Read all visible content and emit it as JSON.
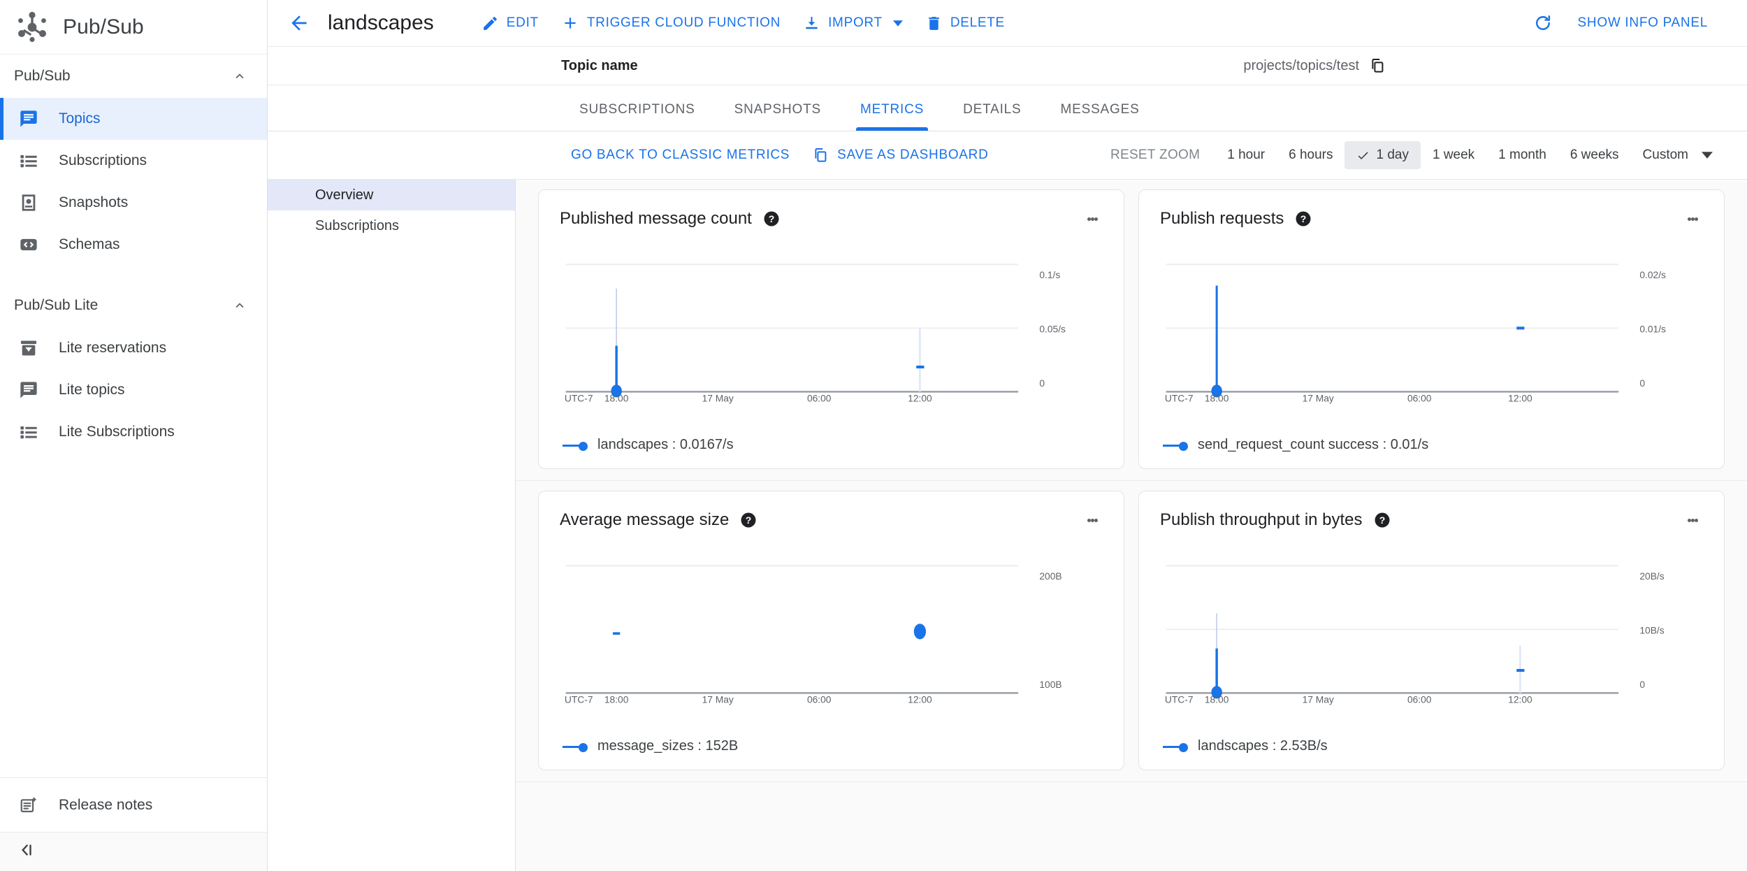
{
  "brand": {
    "title": "Pub/Sub",
    "logo_icon": "pubsub-node-graph-icon"
  },
  "sidebar": {
    "sections": [
      {
        "label": "Pub/Sub",
        "items": [
          {
            "label": "Topics",
            "icon": "chat-bubble-icon",
            "active": true
          },
          {
            "label": "Subscriptions",
            "icon": "list-icon",
            "active": false
          },
          {
            "label": "Snapshots",
            "icon": "snapshot-icon",
            "active": false
          },
          {
            "label": "Schemas",
            "icon": "code-brackets-icon",
            "active": false
          }
        ]
      },
      {
        "label": "Pub/Sub Lite",
        "items": [
          {
            "label": "Lite reservations",
            "icon": "archive-icon",
            "active": false
          },
          {
            "label": "Lite topics",
            "icon": "chat-bubble-icon",
            "active": false
          },
          {
            "label": "Lite Subscriptions",
            "icon": "list-icon",
            "active": false
          }
        ]
      }
    ],
    "release_notes": {
      "label": "Release notes",
      "icon": "release-notes-icon"
    },
    "collapse_icon": "collapse-left-icon"
  },
  "topbar": {
    "back_icon": "arrow-left-icon",
    "title": "landscapes",
    "actions": [
      {
        "label": "EDIT",
        "icon": "pencil-icon"
      },
      {
        "label": "TRIGGER CLOUD FUNCTION",
        "icon": "plus-icon"
      },
      {
        "label": "IMPORT",
        "icon": "import-download-icon",
        "caret": true
      },
      {
        "label": "DELETE",
        "icon": "trash-icon"
      }
    ],
    "refresh_icon": "refresh-icon",
    "info_panel_label": "SHOW INFO PANEL"
  },
  "topic_row": {
    "label": "Topic name",
    "value": "projects/topics/test",
    "copy_icon": "copy-icon"
  },
  "tabs": [
    {
      "label": "SUBSCRIPTIONS",
      "active": false
    },
    {
      "label": "SNAPSHOTS",
      "active": false
    },
    {
      "label": "METRICS",
      "active": true
    },
    {
      "label": "DETAILS",
      "active": false
    },
    {
      "label": "MESSAGES",
      "active": false
    }
  ],
  "metrics_bar": {
    "classic_metrics_label": "GO BACK TO CLASSIC METRICS",
    "save_dashboard_label": "SAVE AS DASHBOARD",
    "save_dashboard_icon": "copy-icon",
    "reset_zoom_label": "RESET ZOOM",
    "ranges": [
      {
        "label": "1 hour",
        "selected": false
      },
      {
        "label": "6 hours",
        "selected": false
      },
      {
        "label": "1 day",
        "selected": true
      },
      {
        "label": "1 week",
        "selected": false
      },
      {
        "label": "1 month",
        "selected": false
      },
      {
        "label": "6 weeks",
        "selected": false
      }
    ],
    "custom_label": "Custom",
    "custom_caret_icon": "caret-down-icon"
  },
  "subnav": [
    {
      "label": "Overview",
      "active": true
    },
    {
      "label": "Subscriptions",
      "active": false
    }
  ],
  "chart_data": [
    {
      "type": "line",
      "title": "Published message count",
      "help_icon": "help-circle-icon",
      "menu_icon": "kebab-menu-icon",
      "xlabel": "",
      "ylabel": "",
      "timezone_label": "UTC-7",
      "xticks": [
        "18:00",
        "17 May",
        "06:00",
        "12:00"
      ],
      "yticks": [
        "0.1/s",
        "0.05/s",
        "0"
      ],
      "ylim": [
        0,
        0.1
      ],
      "grid": true,
      "legend": [
        {
          "name": "landscapes",
          "value": "0.0167/s",
          "text": "landscapes :  0.0167/s",
          "color": "#1a73e8"
        }
      ],
      "series": [
        {
          "name": "landscapes",
          "points": [
            {
              "x": "18:00",
              "y": 0.0167,
              "marker": true,
              "spike_top": 0.0455
            },
            {
              "x": "12:00",
              "y": 0.0083,
              "marker": false,
              "spike_top": 0.05
            }
          ]
        }
      ]
    },
    {
      "type": "line",
      "title": "Publish requests",
      "help_icon": "help-circle-icon",
      "menu_icon": "kebab-menu-icon",
      "xlabel": "",
      "ylabel": "",
      "timezone_label": "UTC-7",
      "xticks": [
        "18:00",
        "17 May",
        "06:00",
        "12:00"
      ],
      "yticks": [
        "0.02/s",
        "0.01/s",
        "0"
      ],
      "ylim": [
        0,
        0.02
      ],
      "grid": true,
      "legend": [
        {
          "name": "send_request_count success",
          "value": "0.01/s",
          "text": "send_request_count success :  0.01/s",
          "color": "#1a73e8"
        }
      ],
      "series": [
        {
          "name": "send_request_count success",
          "points": [
            {
              "x": "18:00",
              "y": 0.01,
              "marker": true,
              "spike_top": 0.0168
            },
            {
              "x": "12:00",
              "y": 0.01,
              "marker": false,
              "spike_top": 0.01
            }
          ]
        }
      ]
    },
    {
      "type": "line",
      "title": "Average message size",
      "help_icon": "help-circle-icon",
      "menu_icon": "kebab-menu-icon",
      "xlabel": "",
      "ylabel": "",
      "timezone_label": "UTC-7",
      "xticks": [
        "18:00",
        "17 May",
        "06:00",
        "12:00"
      ],
      "yticks": [
        "200B",
        "100B"
      ],
      "ylim": [
        100,
        200
      ],
      "grid": true,
      "legend": [
        {
          "name": "message_sizes",
          "value": "152B",
          "text": "message_sizes :  152B",
          "color": "#1a73e8"
        }
      ],
      "series": [
        {
          "name": "message_sizes",
          "points": [
            {
              "x": "18:00",
              "y": 152,
              "marker": false,
              "spike_top": null
            },
            {
              "x": "12:00",
              "y": 152,
              "marker": true,
              "spike_top": null
            }
          ]
        }
      ]
    },
    {
      "type": "line",
      "title": "Publish throughput in bytes",
      "help_icon": "help-circle-icon",
      "menu_icon": "kebab-menu-icon",
      "xlabel": "",
      "ylabel": "",
      "timezone_label": "UTC-7",
      "xticks": [
        "18:00",
        "17 May",
        "06:00",
        "12:00"
      ],
      "yticks": [
        "20B/s",
        "10B/s",
        "0"
      ],
      "ylim": [
        0,
        20
      ],
      "grid": true,
      "legend": [
        {
          "name": "landscapes",
          "value": "2.53B/s",
          "text": "landscapes :  2.53B/s",
          "color": "#1a73e8"
        }
      ],
      "series": [
        {
          "name": "landscapes",
          "points": [
            {
              "x": "18:00",
              "y": 2.53,
              "marker": true,
              "spike_top": 12.0
            },
            {
              "x": "12:00",
              "y": 2.3,
              "marker": false,
              "spike_top": 7.4
            }
          ]
        }
      ]
    }
  ],
  "colors": {
    "accent": "#1a73e8",
    "active_nav_bg": "#e8f0fe",
    "subnav_active_bg": "#e3e7f8",
    "canvas_bg": "#fafafa",
    "series": "#1a73e8"
  }
}
